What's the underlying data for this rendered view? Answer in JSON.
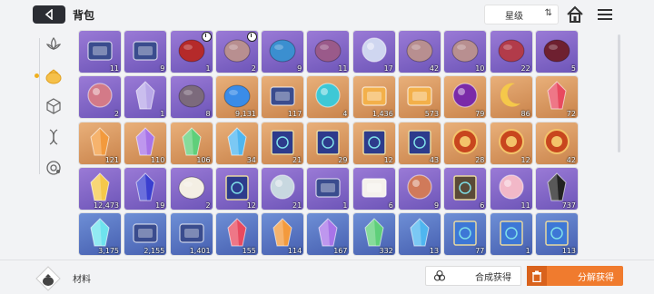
{
  "header": {
    "title": "背包",
    "sort_label": "星级",
    "sort_icon": "⇅"
  },
  "footer": {
    "category_label": "材料",
    "synth_label": "合成获得",
    "decompose_label": "分解获得"
  },
  "colors": {
    "accent": "#f07b2e",
    "purple": "#7a5fc4",
    "orange": "#d8925a",
    "blue": "#5573c2"
  },
  "items": [
    {
      "rarity": "purple",
      "icon": "card-device-icon",
      "count": "11"
    },
    {
      "rarity": "purple",
      "icon": "cards-icon",
      "count": "9"
    },
    {
      "rarity": "purple",
      "icon": "red-cube-icon",
      "count": "1",
      "timed": true
    },
    {
      "rarity": "purple",
      "icon": "brain-core-icon",
      "count": "2",
      "timed": true
    },
    {
      "rarity": "purple",
      "icon": "brain-blue-icon",
      "count": "9"
    },
    {
      "rarity": "purple",
      "icon": "brain-pink-icon",
      "count": "11"
    },
    {
      "rarity": "purple",
      "icon": "sphere-icon",
      "count": "17"
    },
    {
      "rarity": "purple",
      "icon": "flesh-icon",
      "count": "42"
    },
    {
      "rarity": "purple",
      "icon": "flesh-icon",
      "count": "10"
    },
    {
      "rarity": "purple",
      "icon": "red-flesh-icon",
      "count": "22"
    },
    {
      "rarity": "purple",
      "icon": "maw-icon",
      "count": "5"
    },
    {
      "rarity": "purple",
      "icon": "eye-icon",
      "count": "2"
    },
    {
      "rarity": "purple",
      "icon": "crystal-cluster-icon",
      "count": "1"
    },
    {
      "rarity": "purple",
      "icon": "mask-icon",
      "count": "8"
    },
    {
      "rarity": "orange",
      "icon": "blue-splash-icon",
      "count": "9,131"
    },
    {
      "rarity": "orange",
      "icon": "tablet-icon",
      "count": "117"
    },
    {
      "rarity": "orange",
      "icon": "orb-icon",
      "count": "4"
    },
    {
      "rarity": "orange",
      "icon": "ticket-icon",
      "count": "1,436"
    },
    {
      "rarity": "orange",
      "icon": "ticket-gold-icon",
      "count": "573"
    },
    {
      "rarity": "orange",
      "icon": "purple-eye-icon",
      "count": "79"
    },
    {
      "rarity": "orange",
      "icon": "moon-sparkle-icon",
      "count": "86"
    },
    {
      "rarity": "orange",
      "icon": "crystal-red-icon",
      "count": "72"
    },
    {
      "rarity": "orange",
      "icon": "crystal-orange-icon",
      "count": "121"
    },
    {
      "rarity": "orange",
      "icon": "crystal-purple-icon",
      "count": "110"
    },
    {
      "rarity": "orange",
      "icon": "crystal-green-icon",
      "count": "106"
    },
    {
      "rarity": "orange",
      "icon": "crystal-blue-icon",
      "count": "34"
    },
    {
      "rarity": "orange",
      "icon": "spellbook-icon",
      "count": "21"
    },
    {
      "rarity": "orange",
      "icon": "spellbook-icon",
      "count": "29"
    },
    {
      "rarity": "orange",
      "icon": "spellbook-icon",
      "count": "12"
    },
    {
      "rarity": "orange",
      "icon": "spellbook-icon",
      "count": "43"
    },
    {
      "rarity": "orange",
      "icon": "emblem-icon",
      "count": "28"
    },
    {
      "rarity": "orange",
      "icon": "emblem-icon",
      "count": "12"
    },
    {
      "rarity": "orange",
      "icon": "emblem-icon",
      "count": "42"
    },
    {
      "rarity": "purple",
      "icon": "gold-crystals-icon",
      "count": "12,473"
    },
    {
      "rarity": "purple",
      "icon": "dark-gem-icon",
      "count": "19"
    },
    {
      "rarity": "purple",
      "icon": "sneakers-icon",
      "count": "2"
    },
    {
      "rarity": "purple",
      "icon": "book-icon",
      "count": "12"
    },
    {
      "rarity": "purple",
      "icon": "goblet-icon",
      "count": "21"
    },
    {
      "rarity": "purple",
      "icon": "card-stack-icon",
      "count": "1"
    },
    {
      "rarity": "purple",
      "icon": "letter-icon",
      "count": "6"
    },
    {
      "rarity": "purple",
      "icon": "dreamcatcher-icon",
      "count": "9"
    },
    {
      "rarity": "purple",
      "icon": "tome-icon",
      "count": "6"
    },
    {
      "rarity": "purple",
      "icon": "pick-icon",
      "count": "11"
    },
    {
      "rarity": "purple",
      "icon": "urchin-icon",
      "count": "737"
    },
    {
      "rarity": "blue",
      "icon": "cyan-crystals-icon",
      "count": "3,175"
    },
    {
      "rarity": "blue",
      "icon": "device-icon",
      "count": "2,155"
    },
    {
      "rarity": "blue",
      "icon": "device-icon",
      "count": "1,401"
    },
    {
      "rarity": "blue",
      "icon": "shard-red-icon",
      "count": "155"
    },
    {
      "rarity": "blue",
      "icon": "shard-orange-icon",
      "count": "114"
    },
    {
      "rarity": "blue",
      "icon": "shard-purple-icon",
      "count": "167"
    },
    {
      "rarity": "blue",
      "icon": "shard-green-icon",
      "count": "332"
    },
    {
      "rarity": "blue",
      "icon": "shard-blue-icon",
      "count": "13"
    },
    {
      "rarity": "blue",
      "icon": "blue-book-icon",
      "count": "77"
    },
    {
      "rarity": "blue",
      "icon": "blue-book-icon",
      "count": "1"
    },
    {
      "rarity": "blue",
      "icon": "blue-book-icon",
      "count": "113"
    }
  ]
}
